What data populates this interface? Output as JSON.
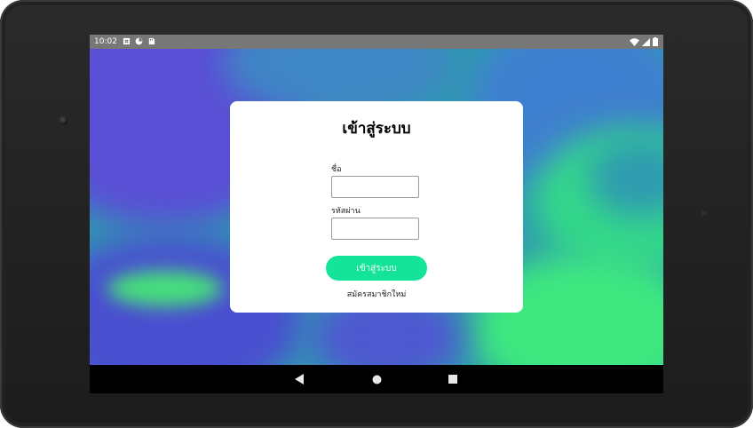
{
  "status_bar": {
    "time": "10:02",
    "left_icons": [
      "sim-card-alert-icon",
      "data-saver-icon",
      "sd-card-icon"
    ],
    "right_icons": [
      "wifi-icon",
      "cellular-signal-icon",
      "battery-icon"
    ]
  },
  "login_card": {
    "title": "เข้าสู่ระบบ",
    "name_label": "ชื่อ",
    "name_value": "",
    "password_label": "รหัสผ่าน",
    "password_value": "",
    "login_button_label": "เข้าสู่ระบบ",
    "register_link_label": "สมัครสมาชิกใหม่"
  },
  "nav_bar": {
    "back_icon": "back-triangle-icon",
    "home_icon": "home-circle-icon",
    "recents_icon": "recents-square-icon"
  },
  "colors": {
    "status_bar": "#777777",
    "accent_button": "#13e49a",
    "background_blue": "#2f9bb0",
    "background_purple": "#5a4fd6",
    "background_green": "#3ee87f"
  }
}
